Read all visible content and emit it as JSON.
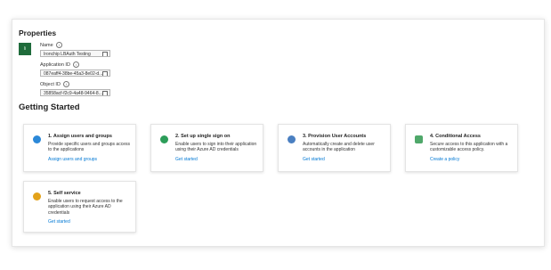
{
  "properties": {
    "title": "Properties",
    "app_icon_text": "li",
    "name_label": "Name",
    "name_value": "Ironchip LBAuth Testing",
    "app_id_label": "Application ID",
    "app_id_value": "087eaff4-38be-45a3-8e02-d...",
    "object_id_label": "Object ID",
    "object_id_value": "35858acf-f2c9-4a48-9464-8..."
  },
  "getting_started": {
    "title": "Getting Started",
    "cards": [
      {
        "title": "1. Assign users and groups",
        "desc": "Provide specific users and groups access to the applications",
        "link": "Assign users and groups",
        "color": "#2b88d8"
      },
      {
        "title": "2. Set up single sign on",
        "desc": "Enable users to sign into their application using their Azure AD credentials",
        "link": "Get started",
        "color": "#2c9d59"
      },
      {
        "title": "3. Provision User Accounts",
        "desc": "Automatically create and delete user accounts in the application",
        "link": "Get started",
        "color": "#4a7fc1"
      },
      {
        "title": "4. Conditional Access",
        "desc": "Secure access to this application with a customizable access policy.",
        "link": "Create a policy",
        "color": "#4fa86a"
      },
      {
        "title": "5. Self service",
        "desc": "Enable users to request access to the application using their Azure AD credentials",
        "link": "Get started",
        "color": "#e3a21a"
      }
    ]
  }
}
